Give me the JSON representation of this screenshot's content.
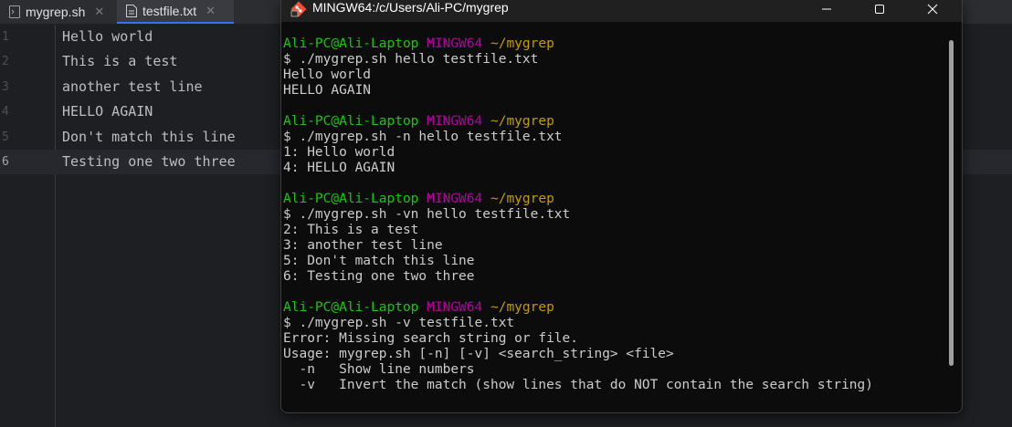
{
  "editor": {
    "tabs": [
      {
        "label": "mygrep.sh",
        "close": "✕"
      },
      {
        "label": "testfile.txt",
        "close": "✕"
      }
    ],
    "lines": [
      {
        "number": "1",
        "text": "Hello world"
      },
      {
        "number": "2",
        "text": "This is a test"
      },
      {
        "number": "3",
        "text": "another test line"
      },
      {
        "number": "4",
        "text": "HELLO AGAIN"
      },
      {
        "number": "5",
        "text": "Don't match this line"
      },
      {
        "number": "6",
        "text": "Testing one two three"
      }
    ]
  },
  "terminal": {
    "title": "MINGW64:/c/Users/Ali-PC/mygrep",
    "prompt": {
      "user": "Ali-PC@Ali-Laptop",
      "host": "MINGW64",
      "path": "~/mygrep"
    },
    "blocks": [
      {
        "command": "$ ./mygrep.sh hello testfile.txt",
        "output": [
          "Hello world",
          "HELLO AGAIN"
        ]
      },
      {
        "command": "$ ./mygrep.sh -n hello testfile.txt",
        "output": [
          "1: Hello world",
          "4: HELLO AGAIN"
        ]
      },
      {
        "command": "$ ./mygrep.sh -vn hello testfile.txt",
        "output": [
          "2: This is a test",
          "3: another test line",
          "5: Don't match this line",
          "6: Testing one two three"
        ]
      },
      {
        "command": "$ ./mygrep.sh -v testfile.txt",
        "output": [
          "Error: Missing search string or file.",
          "Usage: mygrep.sh [-n] [-v] <search_string> <file>",
          "  -n   Show line numbers",
          "  -v   Invert the match (show lines that do NOT contain the search string)"
        ]
      }
    ]
  },
  "colors": {
    "prompt_user": "#16c60c",
    "prompt_host": "#b4009e",
    "prompt_path": "#c19c00",
    "editor_bg": "#1e1f22",
    "terminal_bg": "#0c0c0c",
    "tab_accent": "#3574f0"
  },
  "icons": {
    "terminal_app": "git-bash-icon",
    "file": "text-file-icon",
    "window_controls": [
      "minimize-icon",
      "maximize-icon",
      "close-icon"
    ]
  }
}
